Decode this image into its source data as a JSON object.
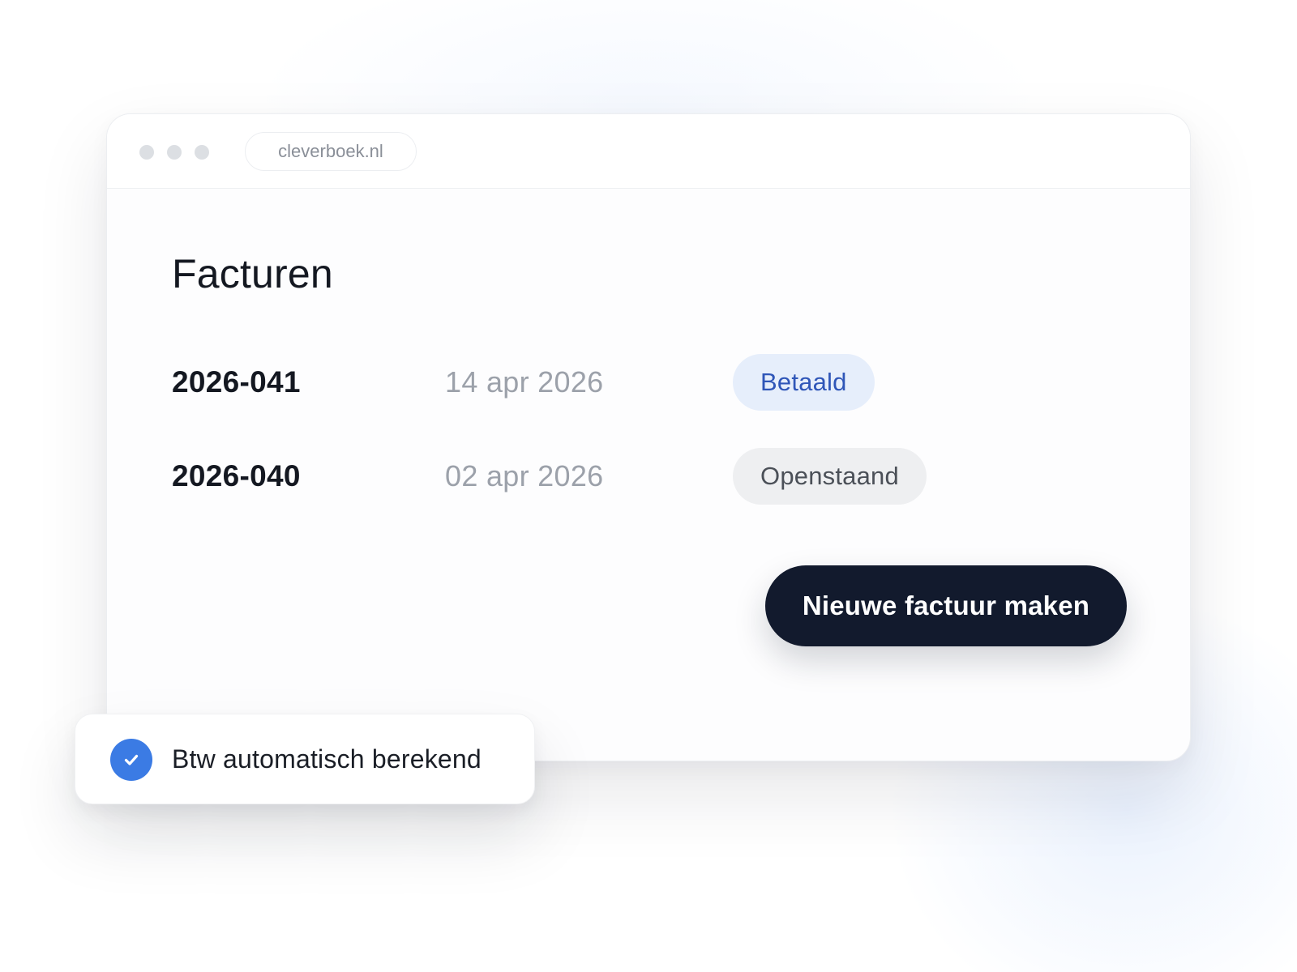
{
  "browser": {
    "url": "cleverboek.nl"
  },
  "page": {
    "title": "Facturen"
  },
  "invoices": [
    {
      "number": "2026-041",
      "date": "14 apr 2026",
      "status": "Betaald",
      "status_type": "paid"
    },
    {
      "number": "2026-040",
      "date": "02 apr 2026",
      "status": "Openstaand",
      "status_type": "open"
    }
  ],
  "actions": {
    "new_invoice_label": "Nieuwe factuur maken"
  },
  "toast": {
    "icon": "check-icon",
    "text": "Btw automatisch berekend"
  },
  "colors": {
    "primary_button": "#121a2d",
    "paid_badge_bg": "#e6eefb",
    "paid_badge_text": "#2f56b8",
    "open_badge_bg": "#eeeff1",
    "check_icon": "#3b7be4"
  }
}
